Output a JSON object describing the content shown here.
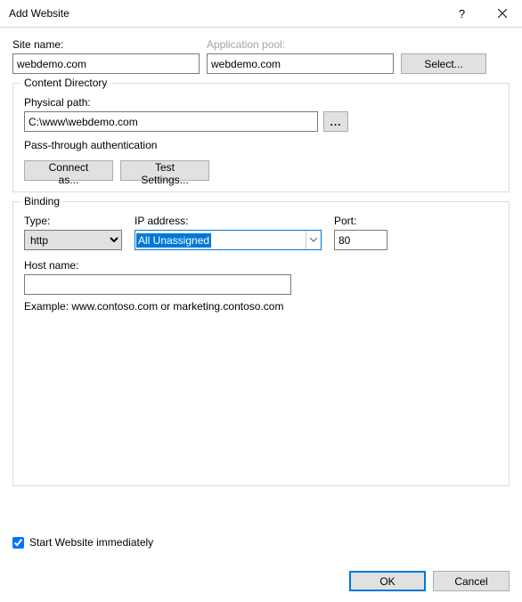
{
  "title": "Add Website",
  "site_name_label": "Site name:",
  "site_name_value": "webdemo.com",
  "app_pool_label": "Application pool:",
  "app_pool_value": "webdemo.com",
  "select_btn": "Select...",
  "content_dir_legend": "Content Directory",
  "physical_path_label": "Physical path:",
  "physical_path_value": "C:\\www\\webdemo.com",
  "pass_through": "Pass-through authentication",
  "connect_as_btn": "Connect as...",
  "test_settings_btn": "Test Settings...",
  "binding_legend": "Binding",
  "type_label": "Type:",
  "type_value": "http",
  "ip_label": "IP address:",
  "ip_value": "All Unassigned",
  "port_label": "Port:",
  "port_value": "80",
  "host_label": "Host name:",
  "host_value": "",
  "example_text": "Example: www.contoso.com or marketing.contoso.com",
  "start_immediately": "Start Website immediately",
  "ok_btn": "OK",
  "cancel_btn": "Cancel",
  "browse_dots": "..."
}
